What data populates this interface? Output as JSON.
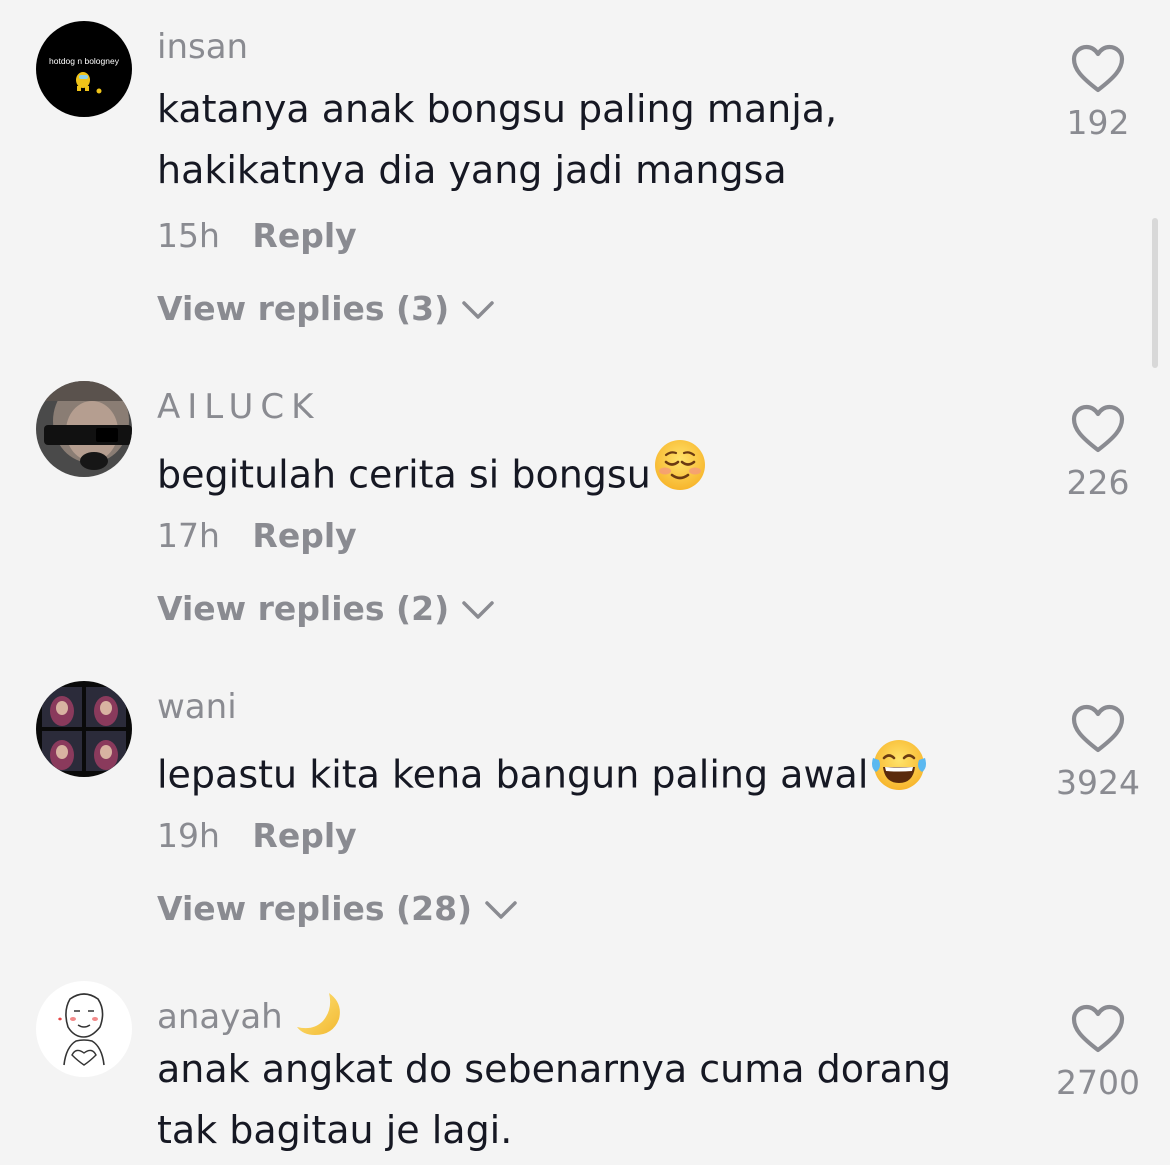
{
  "comments": [
    {
      "username": "insan",
      "avatar_text": "hotdog n bologney",
      "text_lines": [
        "katanya anak bongsu paling manja,",
        "hakikatnya dia yang jadi mangsa"
      ],
      "time": "15h",
      "reply_label": "Reply",
      "view_replies": "View replies (3)",
      "likes": "192"
    },
    {
      "username": "AILUCK",
      "text_lines": [
        "begitulah cerita si bongsu"
      ],
      "emoji": "relieved-face",
      "time": "17h",
      "reply_label": "Reply",
      "view_replies": "View replies (2)",
      "likes": "226"
    },
    {
      "username": "wani",
      "text_lines": [
        "lepastu kita kena bangun paling awal"
      ],
      "emoji": "tears-of-joy-face",
      "time": "19h",
      "reply_label": "Reply",
      "view_replies": "View replies (28)",
      "likes": "3924"
    },
    {
      "username": "anayah",
      "username_emoji": "crescent-moon",
      "text_lines": [
        "anak angkat do sebenarnya cuma dorang",
        "tak bagitau je lagi."
      ],
      "likes": "2700"
    }
  ],
  "colors": {
    "background": "#f4f4f4",
    "text_primary": "#161823",
    "text_secondary": "#8a8b91"
  }
}
